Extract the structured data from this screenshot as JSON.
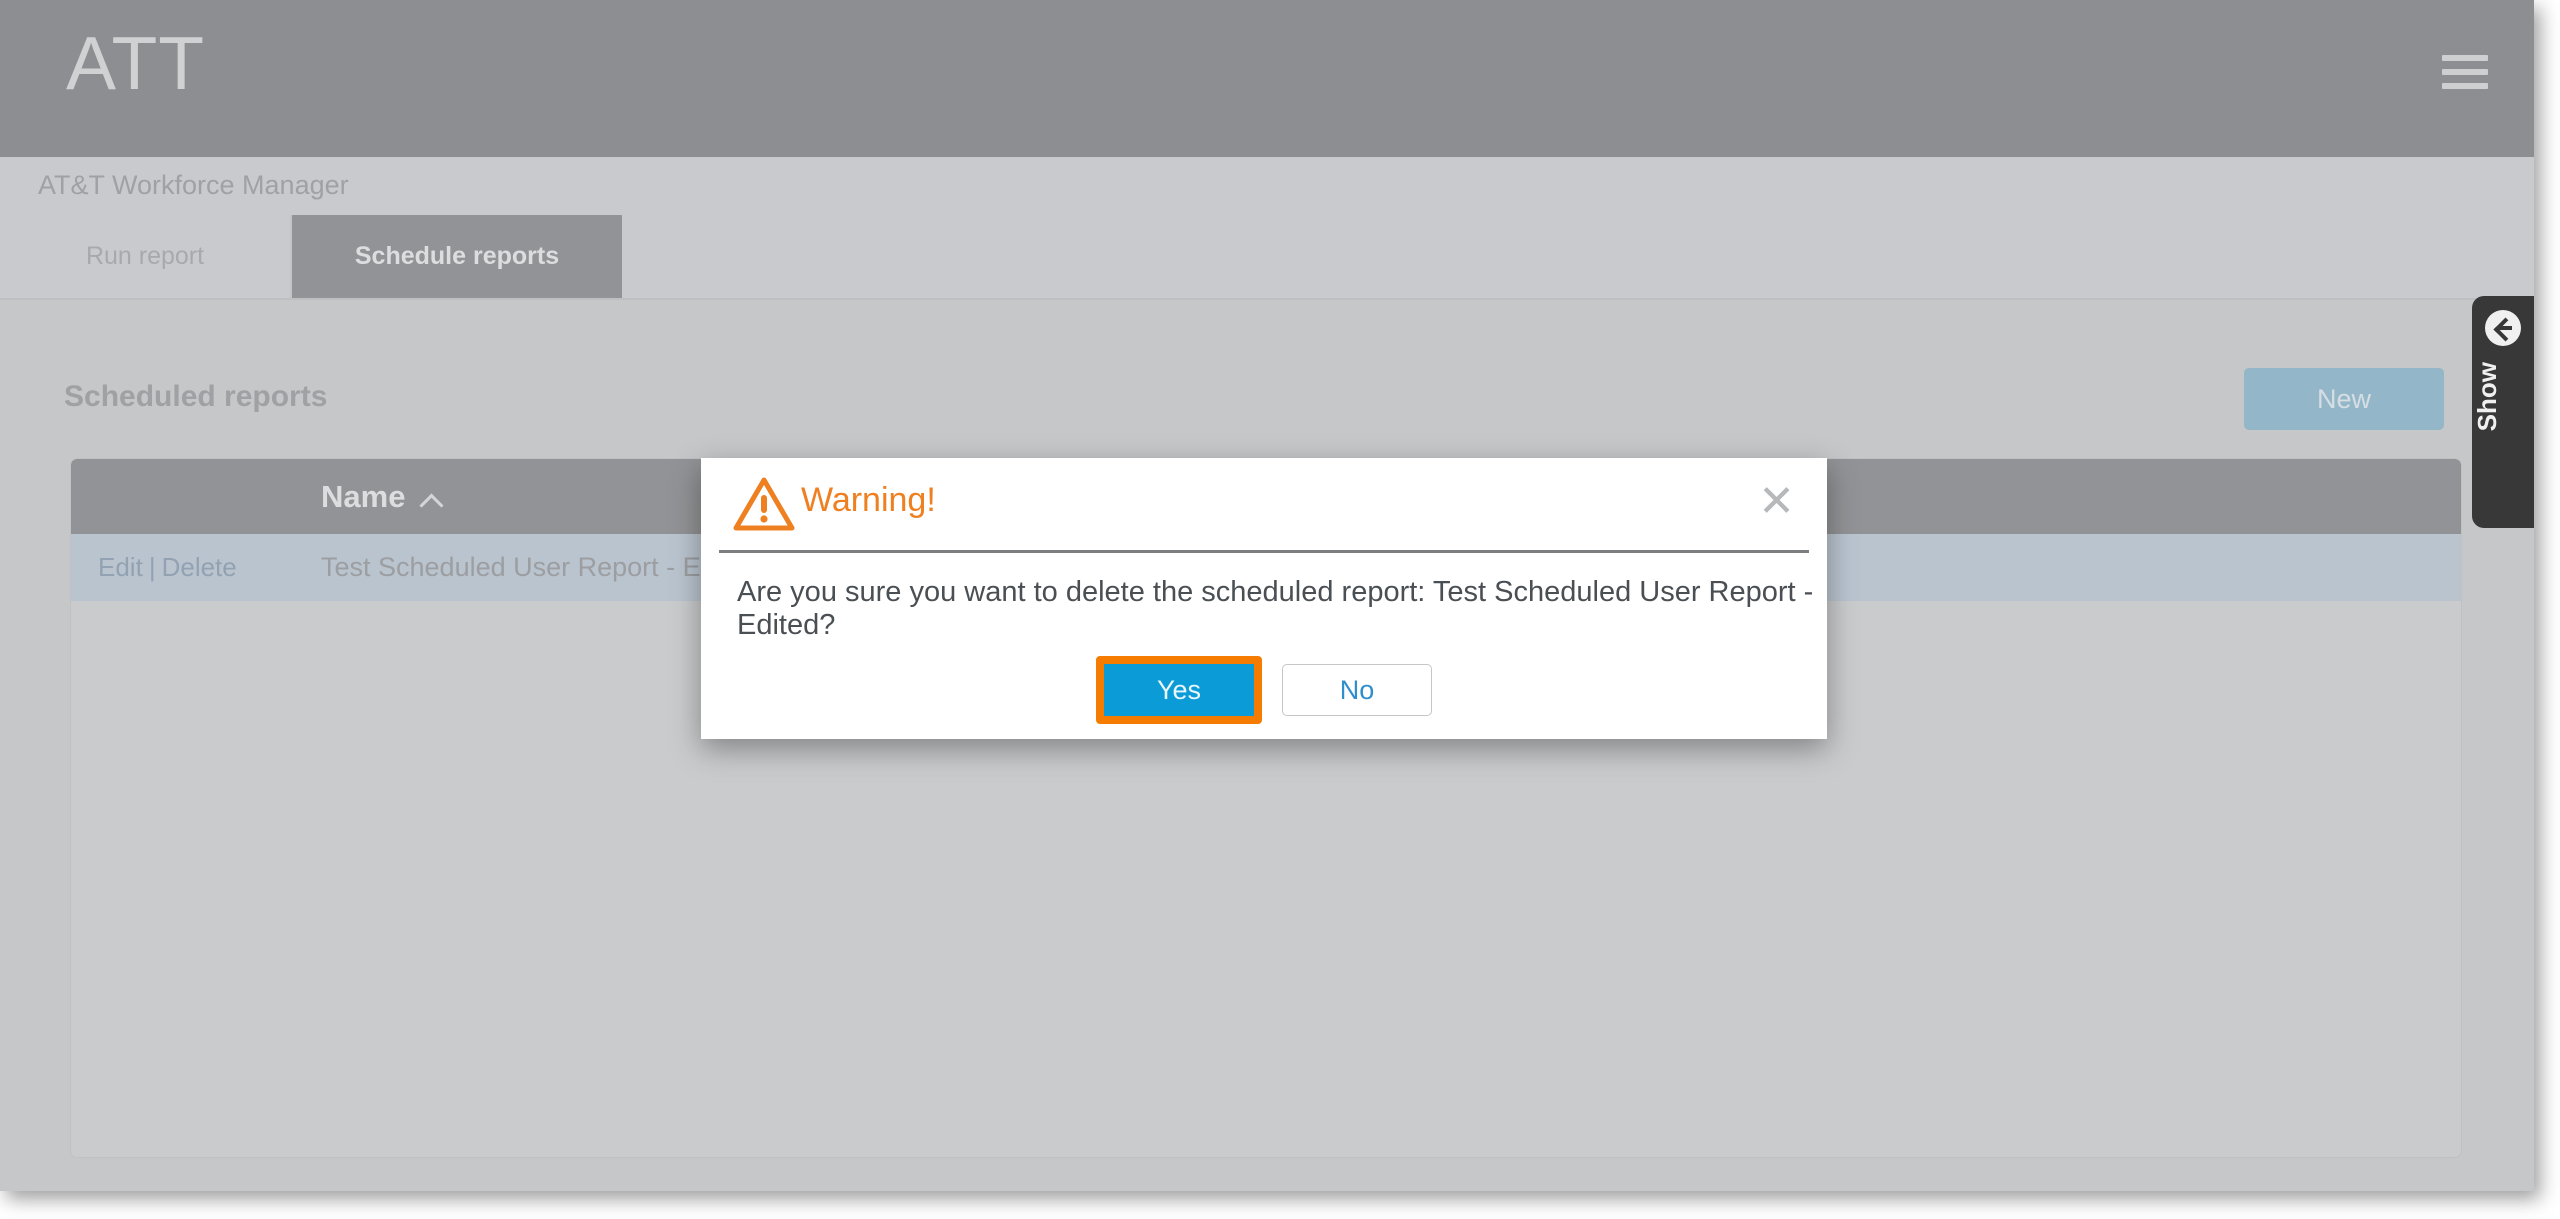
{
  "header": {
    "logo_text": "ATT",
    "menu_icon": "hamburger-menu-icon",
    "app_title": "AT&T Workforce Manager"
  },
  "tabs": [
    {
      "label": "Run report",
      "active": false
    },
    {
      "label": "Schedule reports",
      "active": true
    }
  ],
  "content": {
    "title": "Scheduled reports",
    "new_button_label": "New"
  },
  "table": {
    "columns": [
      "",
      "Name"
    ],
    "sort_column": "Name",
    "sort_direction": "ascending",
    "sort_icon": "chevron-up-icon",
    "rows": [
      {
        "edit_label": "Edit",
        "separator": "|",
        "delete_label": "Delete",
        "name": "Test Scheduled User Report - Edited"
      }
    ]
  },
  "side_tab": {
    "label": "Show",
    "icon": "circle-arrow-left-icon"
  },
  "dialog": {
    "title": "Warning!",
    "icon": "warning-triangle-icon",
    "close_icon": "close-icon",
    "message": "Are you sure you want to delete the scheduled report: Test Scheduled User Report - Edited?",
    "confirm_label": "Yes",
    "cancel_label": "No"
  },
  "colors": {
    "brand_bar": "#77787b",
    "app_bar": "#c9cbcd",
    "page_bg": "#c4c6c8",
    "tab_active": "#7d7f82",
    "table_header": "#7d7f82",
    "row_highlight": "#b5c3d0",
    "accent_blue": "#0b9cd8",
    "new_button": "#7fb0c6",
    "warning_orange": "#ef8021",
    "focus_ring_orange": "#f57c00",
    "side_tab": "#000000"
  }
}
